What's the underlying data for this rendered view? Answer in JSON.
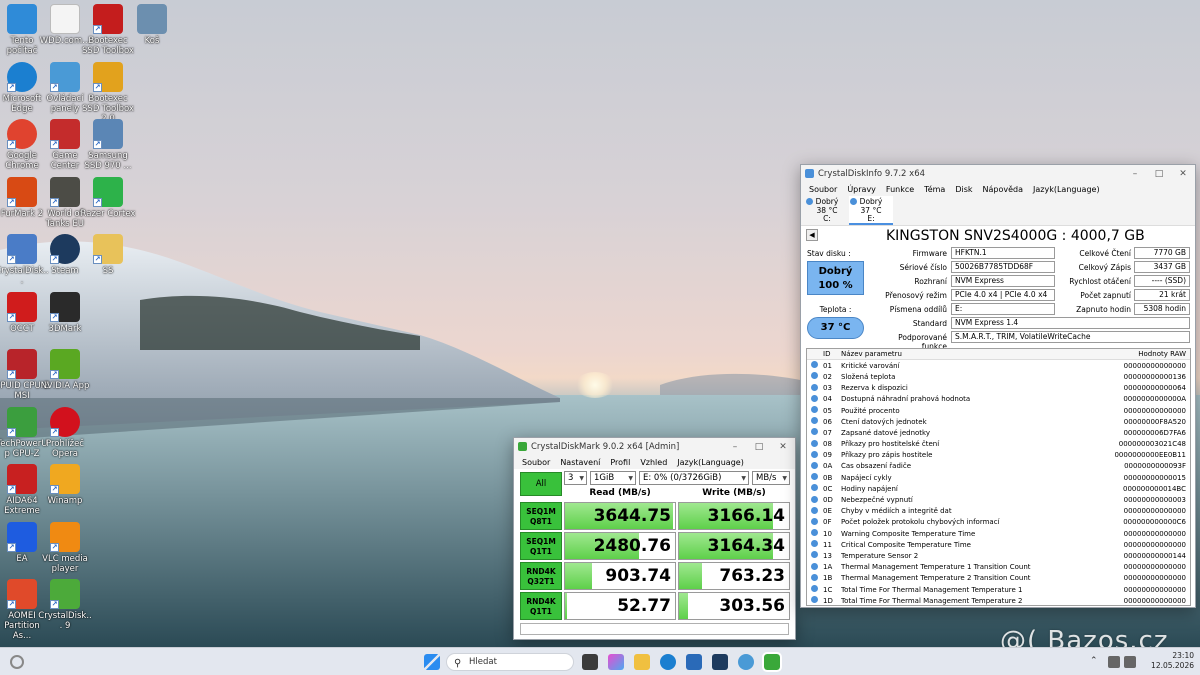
{
  "desktop": {
    "icons": [
      {
        "label": "Tento počítač",
        "color": "#2f8bd8",
        "glyph": "monitor"
      },
      {
        "label": "WDD.com...",
        "color": "#f4f4f4",
        "glyph": "document"
      },
      {
        "label": "Bootexec SSD Toolbox",
        "color": "#c41d1d",
        "glyph": "app"
      },
      {
        "label": "Koš",
        "color": "#6c8faf",
        "glyph": "recycle-bin"
      },
      {
        "label": "Microsoft Edge",
        "color": "#1b7fd0",
        "glyph": "edge"
      },
      {
        "label": "Ovládací panely",
        "color": "#4a9ad6",
        "glyph": "control-panel"
      },
      {
        "label": "Bootexec SSD Toolbox 2.0",
        "color": "#e2a21d",
        "glyph": "app"
      },
      {
        "label": "Google Chrome",
        "color": "#e0432f",
        "glyph": "chrome"
      },
      {
        "label": "Game Center",
        "color": "#c42c2c",
        "glyph": "app"
      },
      {
        "label": "Samsung SSD 970 ...",
        "color": "#5b86b5",
        "glyph": "app"
      },
      {
        "label": "FurMark 2",
        "color": "#d84a14",
        "glyph": "app"
      },
      {
        "label": "World of Tanks EU",
        "color": "#4c4c46",
        "glyph": "app"
      },
      {
        "label": "Razer Cortex",
        "color": "#2db24a",
        "glyph": "app"
      },
      {
        "label": "CrystalDisk...",
        "color": "#4a7cc7",
        "glyph": "app"
      },
      {
        "label": "Steam",
        "color": "#1d3a5e",
        "glyph": "steam"
      },
      {
        "label": "SS",
        "color": "#e8c25a",
        "glyph": "folder"
      },
      {
        "label": "OCCT",
        "color": "#d01c1c",
        "glyph": "app"
      },
      {
        "label": "3DMark",
        "color": "#2a2a2a",
        "glyph": "app"
      },
      {
        "label": "CPUID CPU-Z MSI",
        "color": "#b8242a",
        "glyph": "app"
      },
      {
        "label": "NVIDIA App",
        "color": "#5aa822",
        "glyph": "app"
      },
      {
        "label": "TechPowerUp GPU-Z",
        "color": "#3b9e3e",
        "glyph": "app"
      },
      {
        "label": "Prohlížeč Opera",
        "color": "#d2111d",
        "glyph": "opera"
      },
      {
        "label": "AIDA64 Extreme",
        "color": "#c82020",
        "glyph": "app"
      },
      {
        "label": "Winamp",
        "color": "#f0a820",
        "glyph": "app"
      },
      {
        "label": "EA",
        "color": "#1e5ce0",
        "glyph": "app"
      },
      {
        "label": "VLC media player",
        "color": "#f08a12",
        "glyph": "vlc"
      },
      {
        "label": "AOMEI Partition As...",
        "color": "#e04a2a",
        "glyph": "app"
      },
      {
        "label": "CrystalDisk... 9",
        "color": "#4caa3a",
        "glyph": "app"
      }
    ]
  },
  "cdm": {
    "title": "CrystalDiskMark 9.0.2 x64 [Admin]",
    "menu": [
      "Soubor",
      "Nastavení",
      "Profil",
      "Vzhled",
      "Jazyk(Language)"
    ],
    "all_label": "All",
    "count": "3",
    "size": "1GiB",
    "drive": "E: 0% (0/3726GiB)",
    "unit": "MB/s",
    "read_header": "Read (MB/s)",
    "write_header": "Write (MB/s)",
    "max_scale": 3700,
    "rows": [
      {
        "l1": "SEQ1M",
        "l2": "Q8T1",
        "read": "3644.75",
        "write": "3166.14"
      },
      {
        "l1": "SEQ1M",
        "l2": "Q1T1",
        "read": "2480.76",
        "write": "3164.34"
      },
      {
        "l1": "RND4K",
        "l2": "Q32T1",
        "read": "903.74",
        "write": "763.23"
      },
      {
        "l1": "RND4K",
        "l2": "Q1T1",
        "read": "52.77",
        "write": "303.56"
      }
    ]
  },
  "cdi": {
    "title": "CrystalDiskInfo 9.7.2 x64",
    "menu": [
      "Soubor",
      "Úpravy",
      "Funkce",
      "Téma",
      "Disk",
      "Nápověda",
      "Jazyk(Language)"
    ],
    "drives": [
      {
        "state": "Dobrý",
        "temp": "38 °C",
        "letter": "C:"
      },
      {
        "state": "Dobrý",
        "temp": "37 °C",
        "letter": "E:"
      }
    ],
    "disk_title": "KINGSTON SNV2S4000G : 4000,7 GB",
    "stav_label": "Stav disku :",
    "stav_value": "Dobrý",
    "stav_pct": "100 %",
    "teplota_label": "Teplota :",
    "teplota_value": "37 °C",
    "left_fields": [
      {
        "label": "Firmware",
        "value": "HFKTN.1"
      },
      {
        "label": "Sériové číslo",
        "value": "50026B7785TDD68F"
      },
      {
        "label": "Rozhraní",
        "value": "NVM Express"
      },
      {
        "label": "Přenosový režim",
        "value": "PCIe 4.0 x4 | PCIe 4.0 x4"
      },
      {
        "label": "Písmena oddílů",
        "value": "E:"
      }
    ],
    "right_fields": [
      {
        "label": "Celkové Čtení",
        "value": "7770 GB"
      },
      {
        "label": "Celkový Zápis",
        "value": "3437 GB"
      },
      {
        "label": "Rychlost otáčení",
        "value": "---- (SSD)"
      },
      {
        "label": "Počet zapnutí",
        "value": "21 krát"
      },
      {
        "label": "Zapnuto hodin",
        "value": "5308 hodin"
      }
    ],
    "standard_label": "Standard",
    "standard_value": "NVM Express 1.4",
    "features_label": "Podporované funkce",
    "features_value": "S.M.A.R.T., TRIM, VolatileWriteCache",
    "smart_headers": {
      "id": "ID",
      "name": "Název parametru",
      "raw": "Hodnoty RAW"
    },
    "smart": [
      {
        "id": "01",
        "name": "Kritické varování",
        "raw": "00000000000000"
      },
      {
        "id": "02",
        "name": "Složená teplota",
        "raw": "00000000000136"
      },
      {
        "id": "03",
        "name": "Rezerva k dispozici",
        "raw": "00000000000064"
      },
      {
        "id": "04",
        "name": "Dostupná náhradní prahová hodnota",
        "raw": "0000000000000A"
      },
      {
        "id": "05",
        "name": "Použité procento",
        "raw": "00000000000000"
      },
      {
        "id": "06",
        "name": "Čtení datových jednotek",
        "raw": "00000000F8A520"
      },
      {
        "id": "07",
        "name": "Zapsané datové jednotky",
        "raw": "000000006D7FA6"
      },
      {
        "id": "08",
        "name": "Příkazy pro hostitelské čtení",
        "raw": "000000003021C48"
      },
      {
        "id": "09",
        "name": "Příkazy pro zápis hostitele",
        "raw": "0000000000EE0B11"
      },
      {
        "id": "0A",
        "name": "Čas obsazení řadiče",
        "raw": "0000000000093F"
      },
      {
        "id": "0B",
        "name": "Napájecí cykly",
        "raw": "00000000000015"
      },
      {
        "id": "0C",
        "name": "Hodiny napájení",
        "raw": "000000000014BC"
      },
      {
        "id": "0D",
        "name": "Nebezpečné vypnutí",
        "raw": "00000000000003"
      },
      {
        "id": "0E",
        "name": "Chyby v médiích a integritě dat",
        "raw": "00000000000000"
      },
      {
        "id": "0F",
        "name": "Počet položek protokolu chybových informací",
        "raw": "000000000000C6"
      },
      {
        "id": "10",
        "name": "Warning Composite Temperature Time",
        "raw": "00000000000000"
      },
      {
        "id": "11",
        "name": "Critical Composite Temperature Time",
        "raw": "00000000000000"
      },
      {
        "id": "13",
        "name": "Temperature Sensor 2",
        "raw": "00000000000144"
      },
      {
        "id": "1A",
        "name": "Thermal Management Temperature 1 Transition Count",
        "raw": "00000000000000"
      },
      {
        "id": "1B",
        "name": "Thermal Management Temperature 2 Transition Count",
        "raw": "00000000000000"
      },
      {
        "id": "1C",
        "name": "Total Time For Thermal Management Temperature 1",
        "raw": "00000000000000"
      },
      {
        "id": "1D",
        "name": "Total Time For Thermal Management Temperature 2",
        "raw": "00000000000000"
      }
    ]
  },
  "taskbar": {
    "search_placeholder": "Hledat",
    "time": "23:10",
    "date": "12.05.2026"
  },
  "watermark": "@( Bazos.cz"
}
